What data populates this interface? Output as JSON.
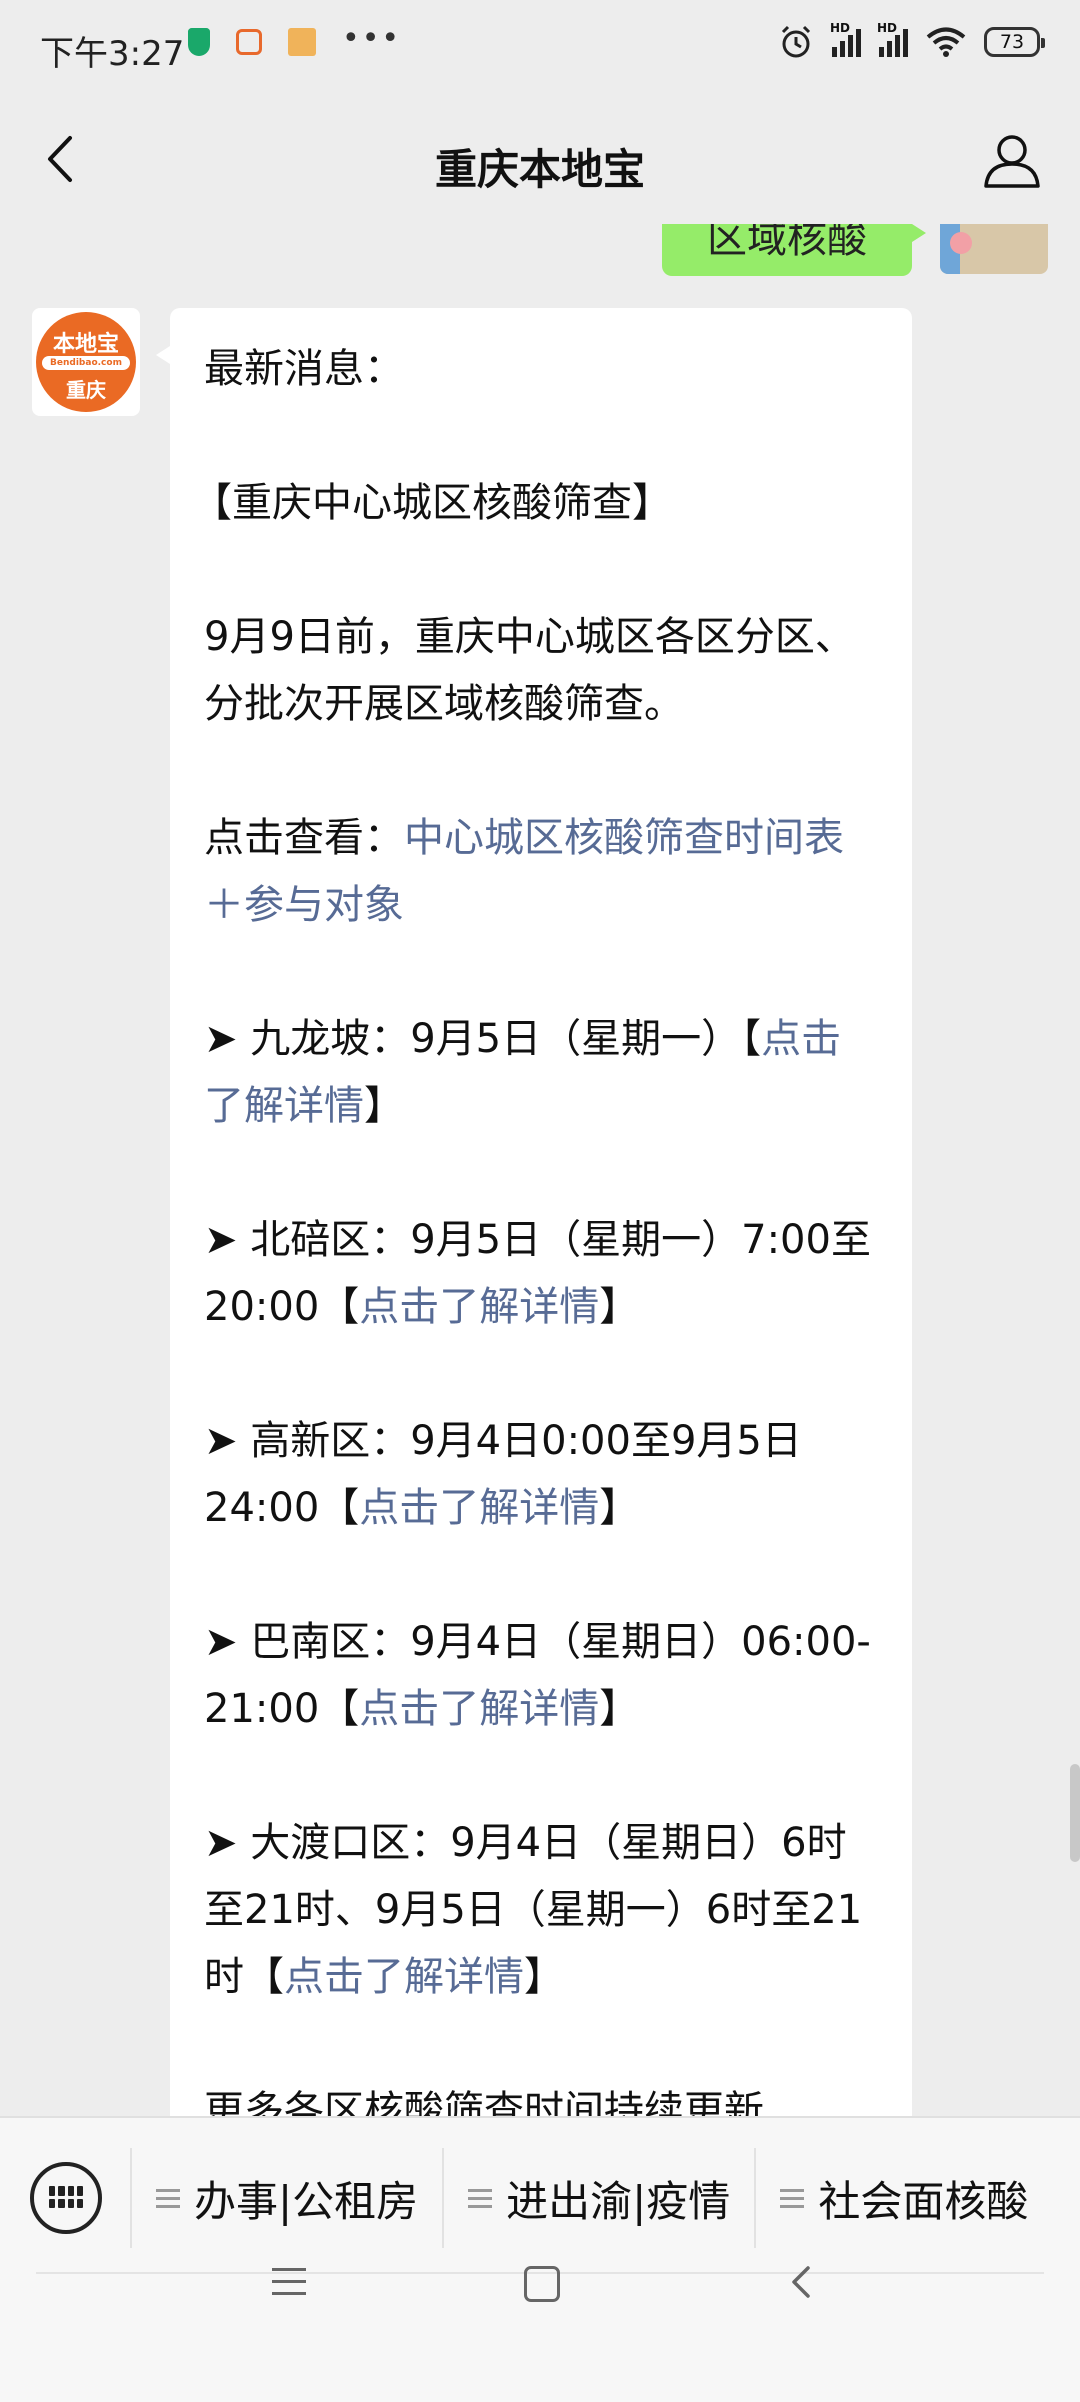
{
  "status_bar": {
    "time": "下午3:27",
    "battery": "73",
    "signal_label": "HD"
  },
  "navbar": {
    "title": "重庆本地宝"
  },
  "chat": {
    "sent_message": "区域核酸",
    "bot_avatar": {
      "brand": "本地宝",
      "domain": "Bendibao.com",
      "city": "重庆"
    },
    "message": {
      "heading": "最新消息：",
      "topic": "【重庆中心城区核酸筛查】",
      "summary": "9月9日前，重庆中心城区各区分区、分批次开展区域核酸筛查。",
      "view_prefix": "点击查看：",
      "view_link": "中心城区核酸筛查时间表＋参与对象",
      "details_link": "点击了解详情",
      "bracket_open": "【",
      "bracket_close": "】",
      "items": [
        {
          "text": "➤ 九龙坡：9月5日（星期一）"
        },
        {
          "text": "➤ 北碚区：9月5日（星期一）7:00至20:00"
        },
        {
          "text": "➤ 高新区：9月4日0:00至9月5日24:00"
        },
        {
          "text": "➤ 巴南区：9月4日（星期日）06:00-21:00"
        },
        {
          "text": "➤ 大渡口区：9月4日（星期日）6时至21时、9月5日（星期一）6时至21时"
        }
      ],
      "footer": "更多各区核酸筛查时间持续更新"
    }
  },
  "bottom_menu": {
    "items": [
      {
        "label": "办事|公租房"
      },
      {
        "label": "进出渝|疫情"
      },
      {
        "label": "社会面核酸"
      }
    ]
  }
}
